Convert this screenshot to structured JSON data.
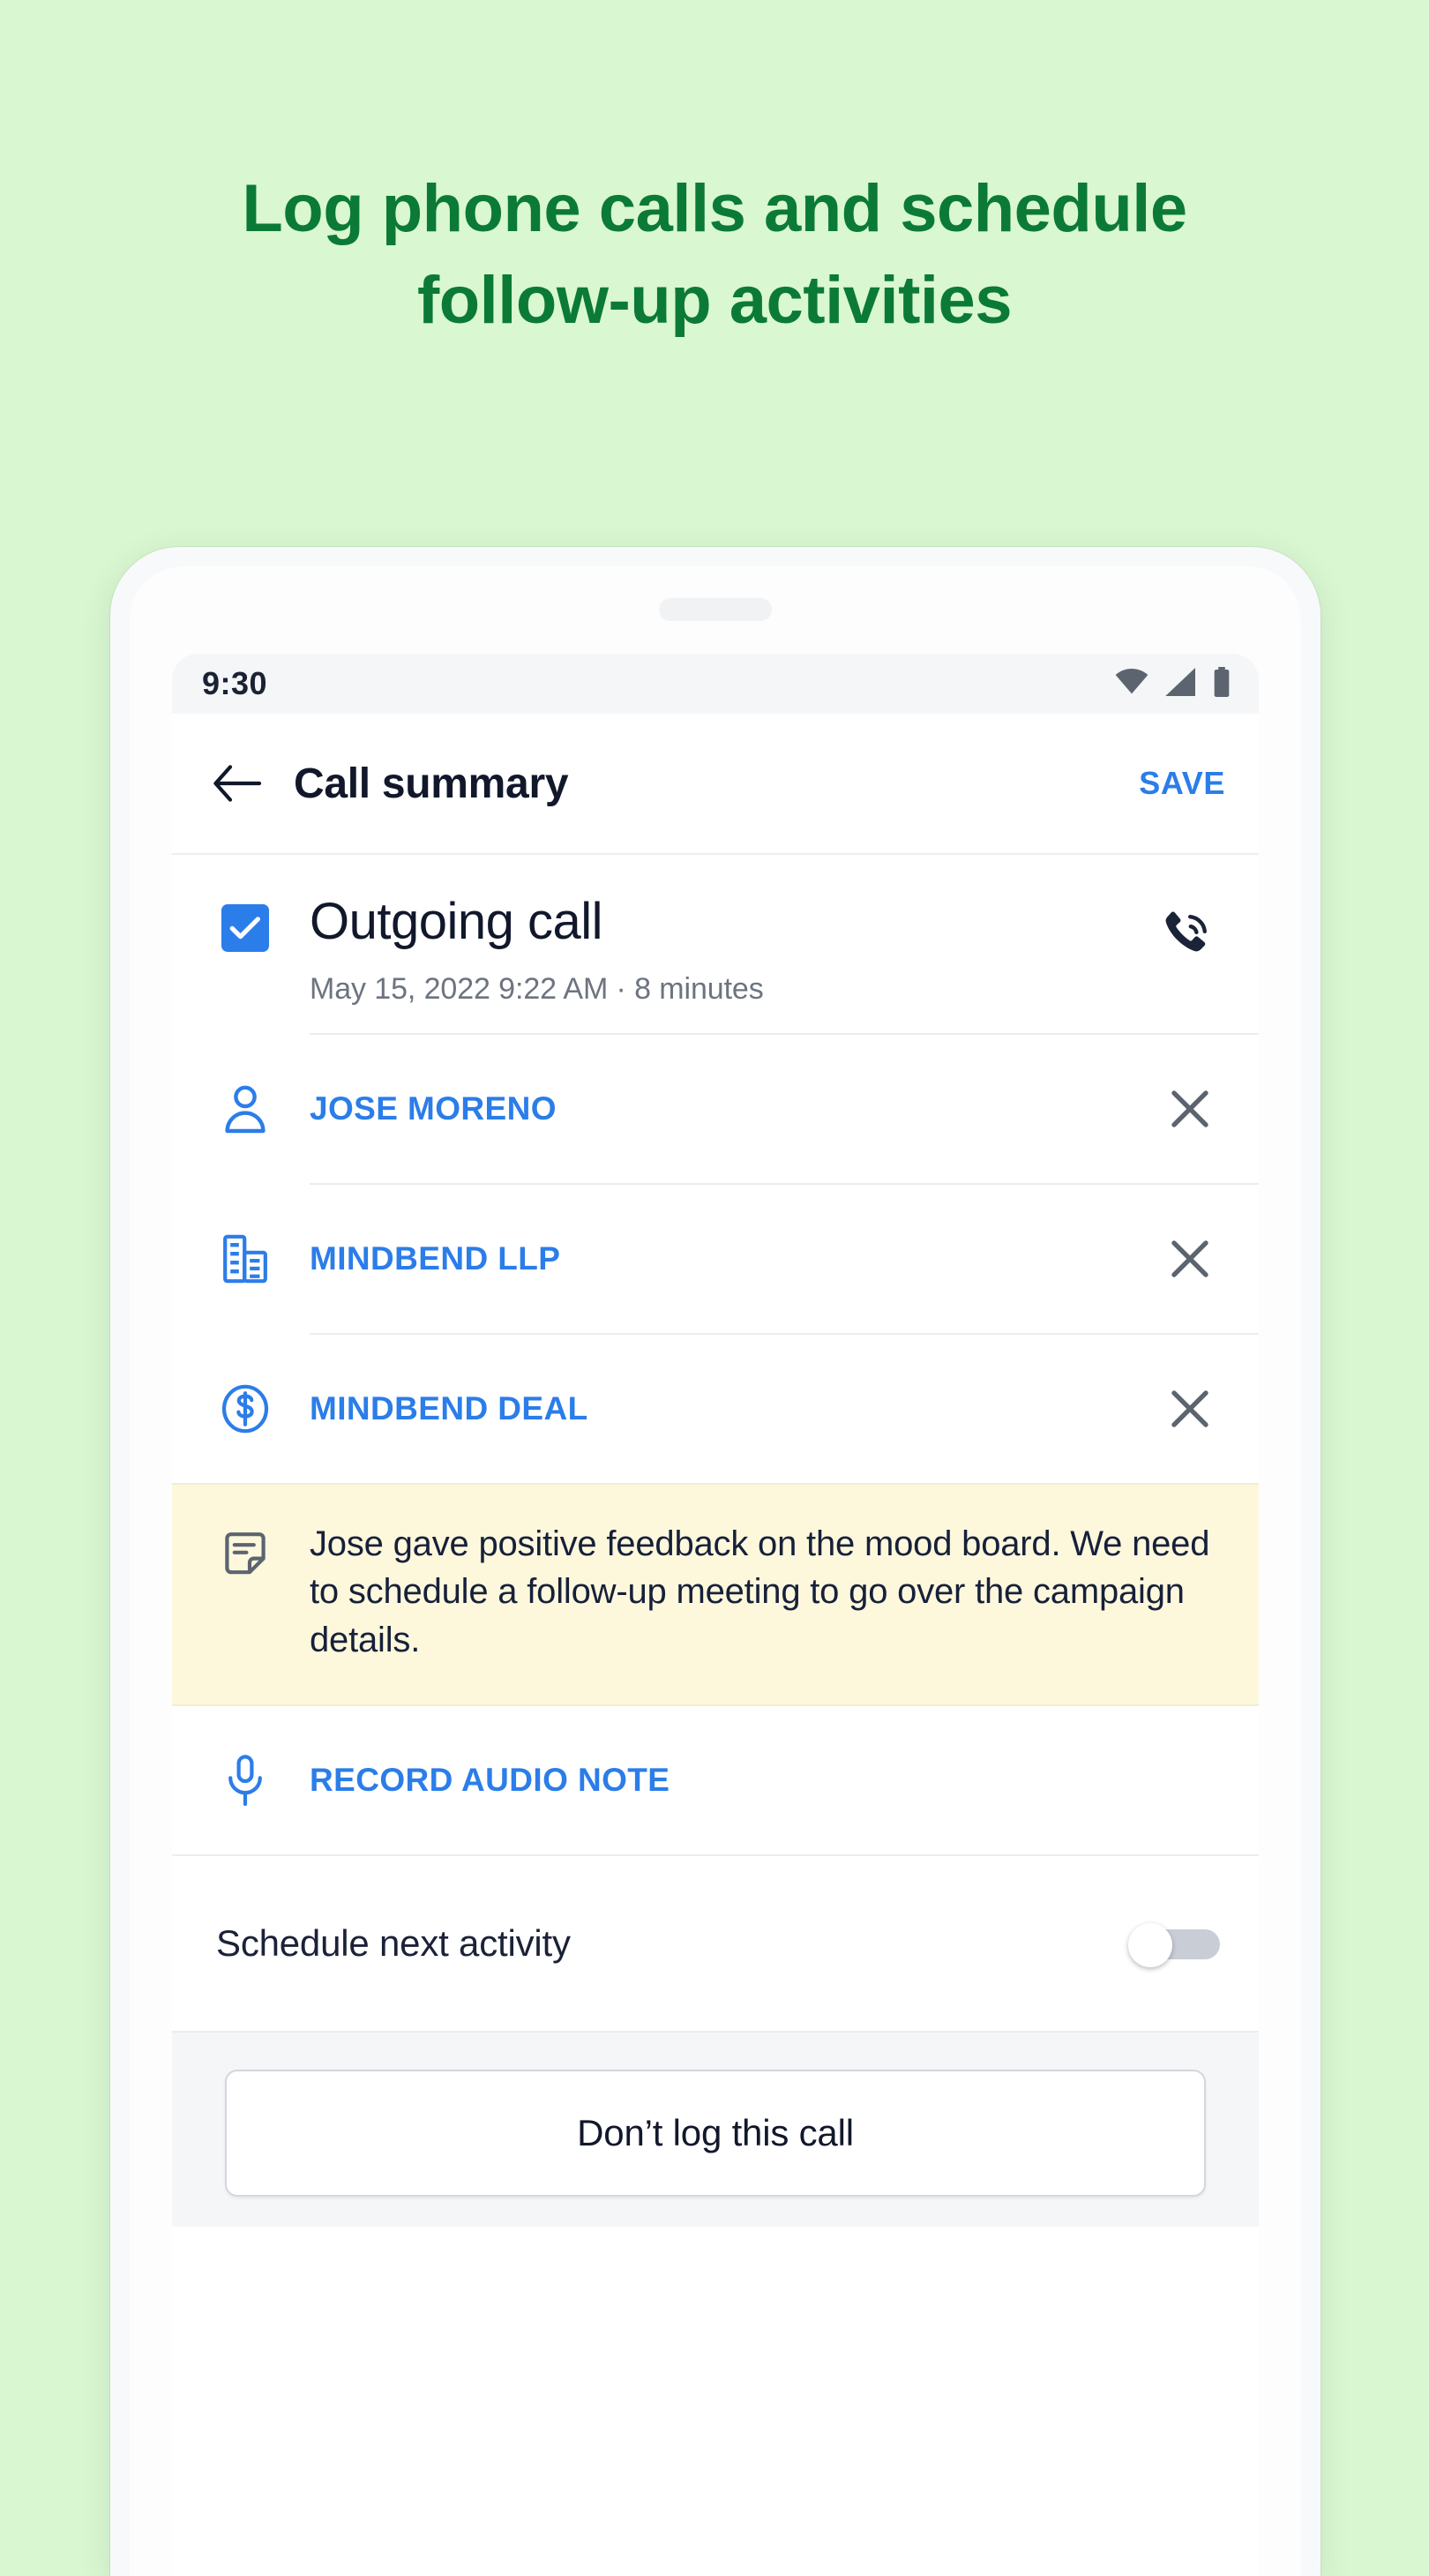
{
  "headline": {
    "line1": "Log phone calls and schedule",
    "line2": "follow-up activities"
  },
  "colors": {
    "page_background": "#d9f7d1",
    "headline_green": "#0b7a36",
    "accent_blue": "#2b7de9",
    "note_yellow": "#fdf8dc",
    "text_dark": "#11182b",
    "text_muted": "#6d7480"
  },
  "status_bar": {
    "time": "9:30",
    "icons": [
      "wifi-icon",
      "cell-signal-icon",
      "battery-icon"
    ]
  },
  "app_bar": {
    "back_icon": "arrow-left-icon",
    "title": "Call summary",
    "action_label": "SAVE"
  },
  "call": {
    "checkbox_checked": true,
    "title": "Outgoing call",
    "meta": "May 15, 2022 9:22 AM · 8 minutes",
    "type_icon": "phone-outgoing-ring-icon"
  },
  "linked_records": [
    {
      "icon": "person-icon",
      "label": "JOSE MORENO",
      "remove_icon": "close-x-icon"
    },
    {
      "icon": "building-icon",
      "label": "MINDBEND LLP",
      "remove_icon": "close-x-icon"
    },
    {
      "icon": "deal-dollar-icon",
      "label": "MINDBEND DEAL",
      "remove_icon": "close-x-icon"
    }
  ],
  "note": {
    "icon": "sticky-note-icon",
    "text": "Jose gave positive feedback on the mood board. We need to schedule a follow-up meeting to go over the campaign details."
  },
  "audio_note": {
    "icon": "microphone-icon",
    "label": "RECORD AUDIO NOTE"
  },
  "schedule": {
    "label": "Schedule next activity",
    "toggle_on": false
  },
  "bottom": {
    "dont_log_label": "Don’t log this call"
  }
}
